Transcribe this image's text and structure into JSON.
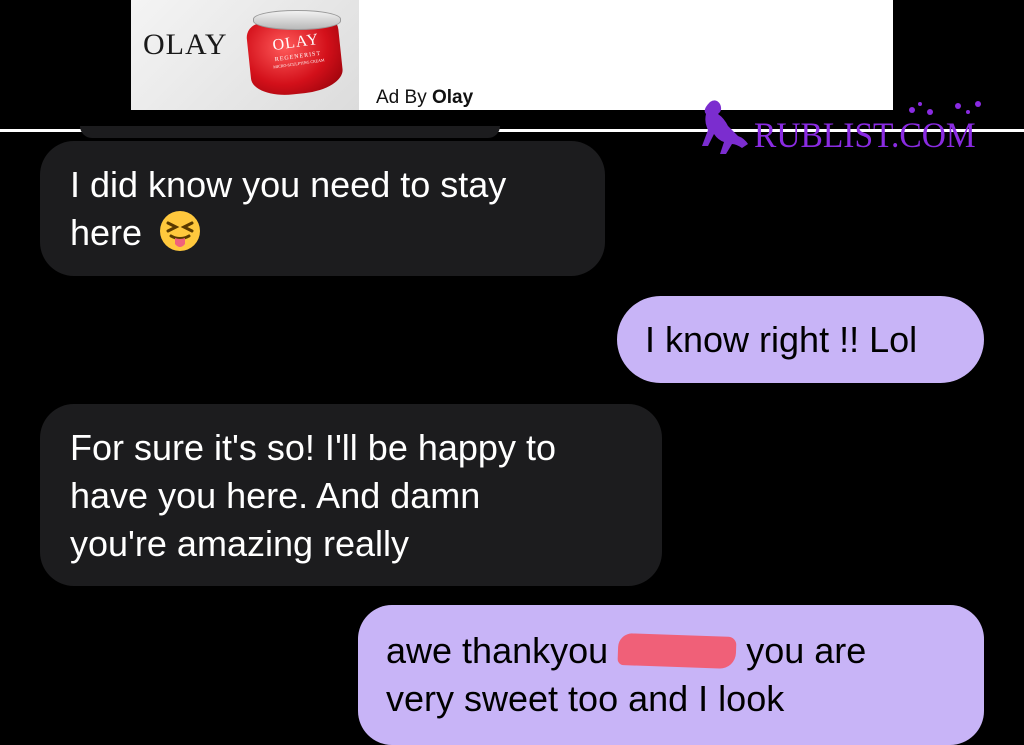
{
  "ad": {
    "brand_word": "OLAY",
    "jar_brand": "OLAY",
    "jar_line": "REGENERIST",
    "jar_sub": "MICRO-SCULPTING CREAM",
    "caption_prefix": "Ad By",
    "caption_brand": "Olay",
    "colors": {
      "jar_red": "#d3101a",
      "background": "#ffffff"
    }
  },
  "watermark": {
    "text": "RUBLIST.COM",
    "color": "#8a2be2"
  },
  "messages": [
    {
      "direction": "incoming",
      "lines": [
        "I did know you need to stay",
        "here"
      ],
      "emoji": "squinting-face-with-tongue"
    },
    {
      "direction": "outgoing",
      "lines": [
        "I know right !! Lol"
      ]
    },
    {
      "direction": "incoming",
      "lines": [
        "For sure it's so! I'll be happy to",
        "have you here. And damn",
        "you're amazing really"
      ]
    },
    {
      "direction": "outgoing",
      "line1_before": "awe thankyou",
      "line1_after": "you are",
      "lines": [
        "very sweet too and I look"
      ],
      "redacted": true
    }
  ],
  "colors": {
    "background": "#000000",
    "incoming_bubble": "#1c1c1e",
    "outgoing_bubble": "#c8b4f7",
    "redaction": "#f06078"
  }
}
